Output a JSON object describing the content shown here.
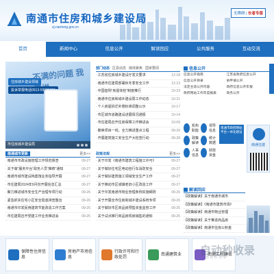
{
  "header": {
    "title": "南通市住房和城乡建设局",
    "domain": "zj.nantong.gov.cn",
    "badge_a": "无障碍",
    "badge_b": "长者专版"
  },
  "nav": {
    "items": [
      "首页",
      "新闻中心",
      "信息公开",
      "解读回应",
      "公共服务",
      "互动交流"
    ]
  },
  "slider": {
    "big_text": "不满的问题 我来说",
    "pill_1": "住房城乡建设领域",
    "pill_2": "投诉举报电话0513-59000355",
    "caption": "市住房城乡建设局"
  },
  "left_news": {
    "tabs": [
      "南通城市更新"
    ],
    "more": "更多>>",
    "items": [
      {
        "t": "南通市市政设施管理工作规范督查",
        "d": "09-27"
      },
      {
        "t": "关于做“服务平台”政务人员“推荐”通知",
        "d": "09-27"
      },
      {
        "t": "南通市城市建设档案馆业务指导开展",
        "d": "09-27"
      },
      {
        "t": "市住建局2024年9月份开展信息汇总",
        "d": "09-27"
      },
      {
        "t": "聚力推进城市安全生产治理专项行动",
        "d": "09-26"
      },
      {
        "t": "紧急抓实住宅小区安全隐患排查整治",
        "d": "09-26"
      },
      {
        "t": "南通市印发民用建筑节能改造工作方案",
        "d": "09-25"
      },
      {
        "t": "市住建局召开党建工作业务推进会",
        "d": "09-25"
      }
    ]
  },
  "news_center": {
    "tabs": [
      "部门动态",
      "区县动态",
      "媒体聚焦",
      "国家要闻"
    ],
    "more": "更多>>",
    "items": [
      {
        "t": "江苏省住房城乡建设厅发文要求",
        "d": "12-18"
      },
      {
        "t": "南通市住建局部署秋冬季安全工作",
        "d": "12-13"
      },
      {
        "t": "中国首例“房屋体检”制度推行",
        "d": "10-23"
      },
      {
        "t": "南通市住房和城乡建设局工作动态",
        "d": "10-21"
      },
      {
        "t": "个人房屋拆迁补偿标准调整公示",
        "d": "10-17"
      },
      {
        "t": "市区城市道路建设进展情况通报",
        "d": "10-14"
      },
      {
        "t": "市住建局召开住房保障工作推进会",
        "d": "10-09"
      },
      {
        "t": "聚焦项目一线，全力推进重点工程",
        "d": "09-29"
      },
      {
        "t": "开展建筑施工安全生产大检查行动",
        "d": "09-28"
      }
    ]
  },
  "policy": {
    "title": "政策法规",
    "more": "更多>>",
    "items": [
      {
        "t": "关于印发《南通市建筑工程施工许可》",
        "d": "09-27"
      },
      {
        "t": "关于做好住宅区电动自行车消防安全",
        "d": "09-27"
      },
      {
        "t": "关于做好建筑施工领域安全生产工作",
        "d": "09-27"
      },
      {
        "t": "关于推动市区城镇老旧小区改造工作",
        "d": "09-27"
      },
      {
        "t": "关于印发南通市物业管理条例实施细则",
        "d": "09-26"
      },
      {
        "t": "关于开展全市住房和城乡建设系统专项",
        "d": "09-26"
      },
      {
        "t": "关于做好市区商品房预售资金监管工作",
        "d": "09-25"
      },
      {
        "t": "关于试点推行商品房现房销售的通知",
        "d": "09-25"
      }
    ]
  },
  "info": {
    "title": "信息公开",
    "items": [
      "信息公开指南",
      "江苏省政府信息公开",
      "信息公开目录",
      "依申请公开",
      "法定主动公开内容",
      "政府信息公开年报",
      "政府网站工作年度报表",
      "政务公开"
    ]
  },
  "icons": [
    {
      "label": "机构职能"
    },
    {
      "label": "领导信息"
    },
    {
      "label": "政策解读"
    },
    {
      "label": "统计数据"
    },
    {
      "label": "人事信息"
    },
    {
      "label": "财政资金"
    }
  ],
  "blue_banner": "南通市政府网站平台一体化建设",
  "app": {
    "name": "南通住建"
  },
  "interp": {
    "title": "解读回应",
    "items": [
      "【政策解读】关于南通市城市",
      "【政策解读】《南通市建筑市场》",
      "【政策解读】南通市物业管理",
      "【政策解读】关于推进商品房",
      "【政策解读】南通市住房公积金"
    ]
  },
  "services": [
    {
      "label": "保障性住房信息"
    },
    {
      "label": "房地产市场信息"
    },
    {
      "label": "行政许可和行政处罚"
    },
    {
      "label": "南通建筑业"
    },
    {
      "label": "南通工程建设"
    }
  ],
  "watermark": "自动秒收录",
  "watermark_sub": "自 动 秒 收 录"
}
